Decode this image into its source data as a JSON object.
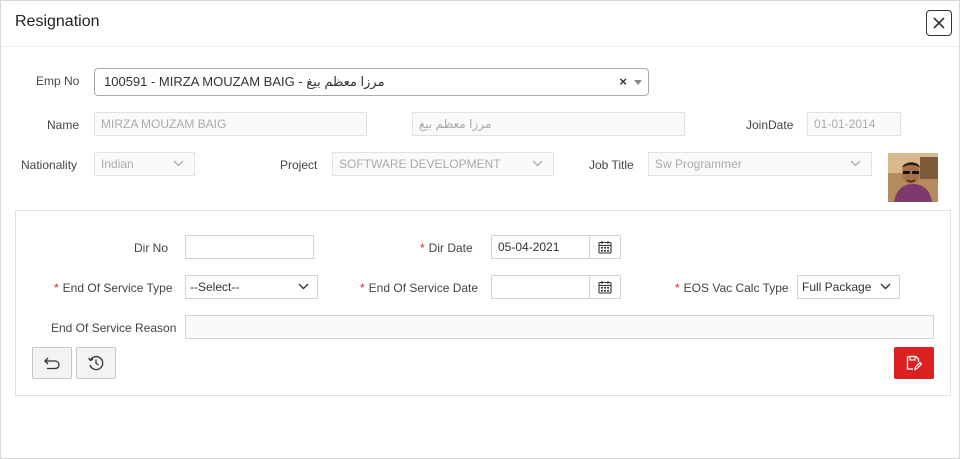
{
  "dialog": {
    "title": "Resignation"
  },
  "employee": {
    "emp_no_label": "Emp No",
    "emp_no_value": "100591 - MIRZA MOUZAM BAIG - مرزا معظم بيغ",
    "clear_glyph": "×",
    "name_label": "Name",
    "name_en": "MIRZA MOUZAM BAIG",
    "name_ar": "مرزا معظم بيغ",
    "joindate_label": "JoinDate",
    "joindate_value": "01-01-2014",
    "nationality_label": "Nationality",
    "nationality_value": "Indian",
    "project_label": "Project",
    "project_value": "SOFTWARE DEVELOPMENT",
    "jobtitle_label": "Job Title",
    "jobtitle_value": "Sw Programmer"
  },
  "form": {
    "required_mark": "*",
    "dir_no_label": "Dir No",
    "dir_no_value": "",
    "dir_date_label": "Dir Date",
    "dir_date_value": "05-04-2021",
    "eos_type_label": "End Of Service Type",
    "eos_type_value": "--Select--",
    "eos_date_label": "End Of Service Date",
    "eos_date_value": "",
    "eos_vac_label": "EOS Vac Calc Type",
    "eos_vac_value": "Full Package",
    "eos_reason_label": "End Of Service Reason",
    "eos_reason_value": ""
  },
  "colors": {
    "accent_red": "#dc1f1f",
    "required": "#d62828"
  },
  "icons": [
    "close-icon",
    "chevron-down-icon",
    "calendar-icon",
    "undo-icon",
    "history-icon",
    "save-edit-icon",
    "employee-photo"
  ]
}
